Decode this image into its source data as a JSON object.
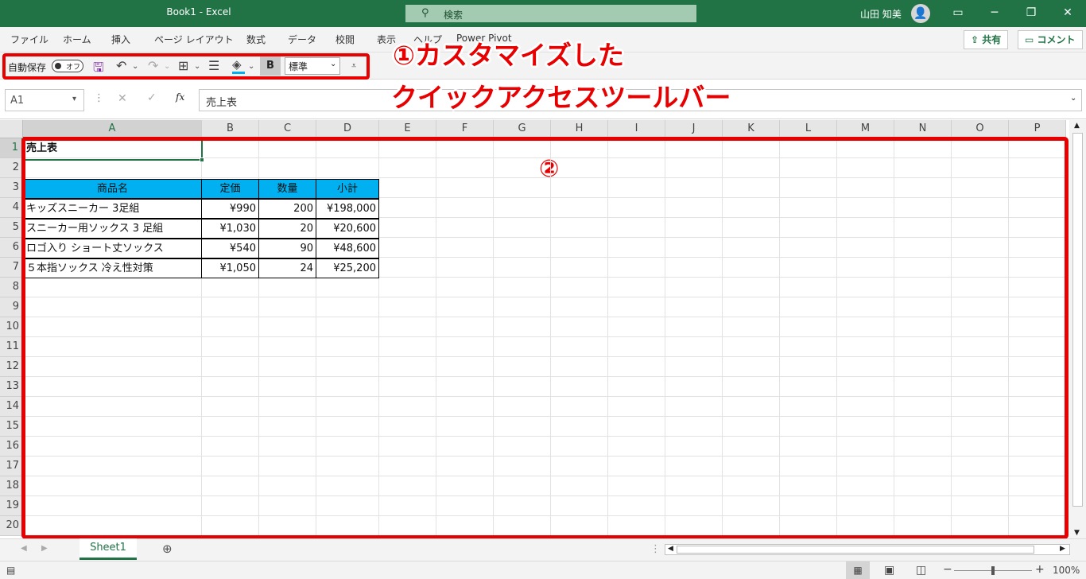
{
  "window": {
    "title": "Book1  -  Excel",
    "search": "検索",
    "user": "山田 知美"
  },
  "menu": [
    "ファイル",
    "ホーム",
    "挿入",
    "ページ レイアウト",
    "数式",
    "データ",
    "校閲",
    "表示",
    "ヘルプ",
    "Power Pivot"
  ],
  "ribbon_buttons": {
    "share": "共有",
    "comment": "コメント"
  },
  "qat": {
    "autosave": "自動保存",
    "toggle": "オフ",
    "style": "標準",
    "bold": "B"
  },
  "formula_bar": {
    "namebox": "A1",
    "fx": "fx",
    "content": "売上表"
  },
  "annotations": {
    "a1_line1": "①カスタマイズした",
    "a1_line2": "クイックアクセスツールバー",
    "a2": "②"
  },
  "columns": [
    "A",
    "B",
    "C",
    "D",
    "E",
    "F",
    "G",
    "H",
    "I",
    "J",
    "K",
    "L",
    "M",
    "N",
    "O",
    "P"
  ],
  "rows": [
    "1",
    "2",
    "3",
    "4",
    "5",
    "6",
    "7",
    "8",
    "9",
    "10",
    "11",
    "12",
    "13",
    "14",
    "15",
    "16",
    "17",
    "18",
    "19",
    "20"
  ],
  "sheet": {
    "title": "売上表",
    "headers": [
      "商品名",
      "定価",
      "数量",
      "小計"
    ],
    "data": [
      [
        "キッズスニーカー 3足組",
        "¥990",
        "200",
        "¥198,000"
      ],
      [
        "スニーカー用ソックス 3 足組",
        "¥1,030",
        "20",
        "¥20,600"
      ],
      [
        "ロゴ入り ショート丈ソックス",
        "¥540",
        "90",
        "¥48,600"
      ],
      [
        "５本指ソックス 冷え性対策",
        "¥1,050",
        "24",
        "¥25,200"
      ]
    ]
  },
  "sheet_tab": "Sheet1",
  "zoom": "100%",
  "colors": {
    "excel_green": "#217346",
    "header_fill": "#00b0f0",
    "annotation_red": "#e80000"
  }
}
